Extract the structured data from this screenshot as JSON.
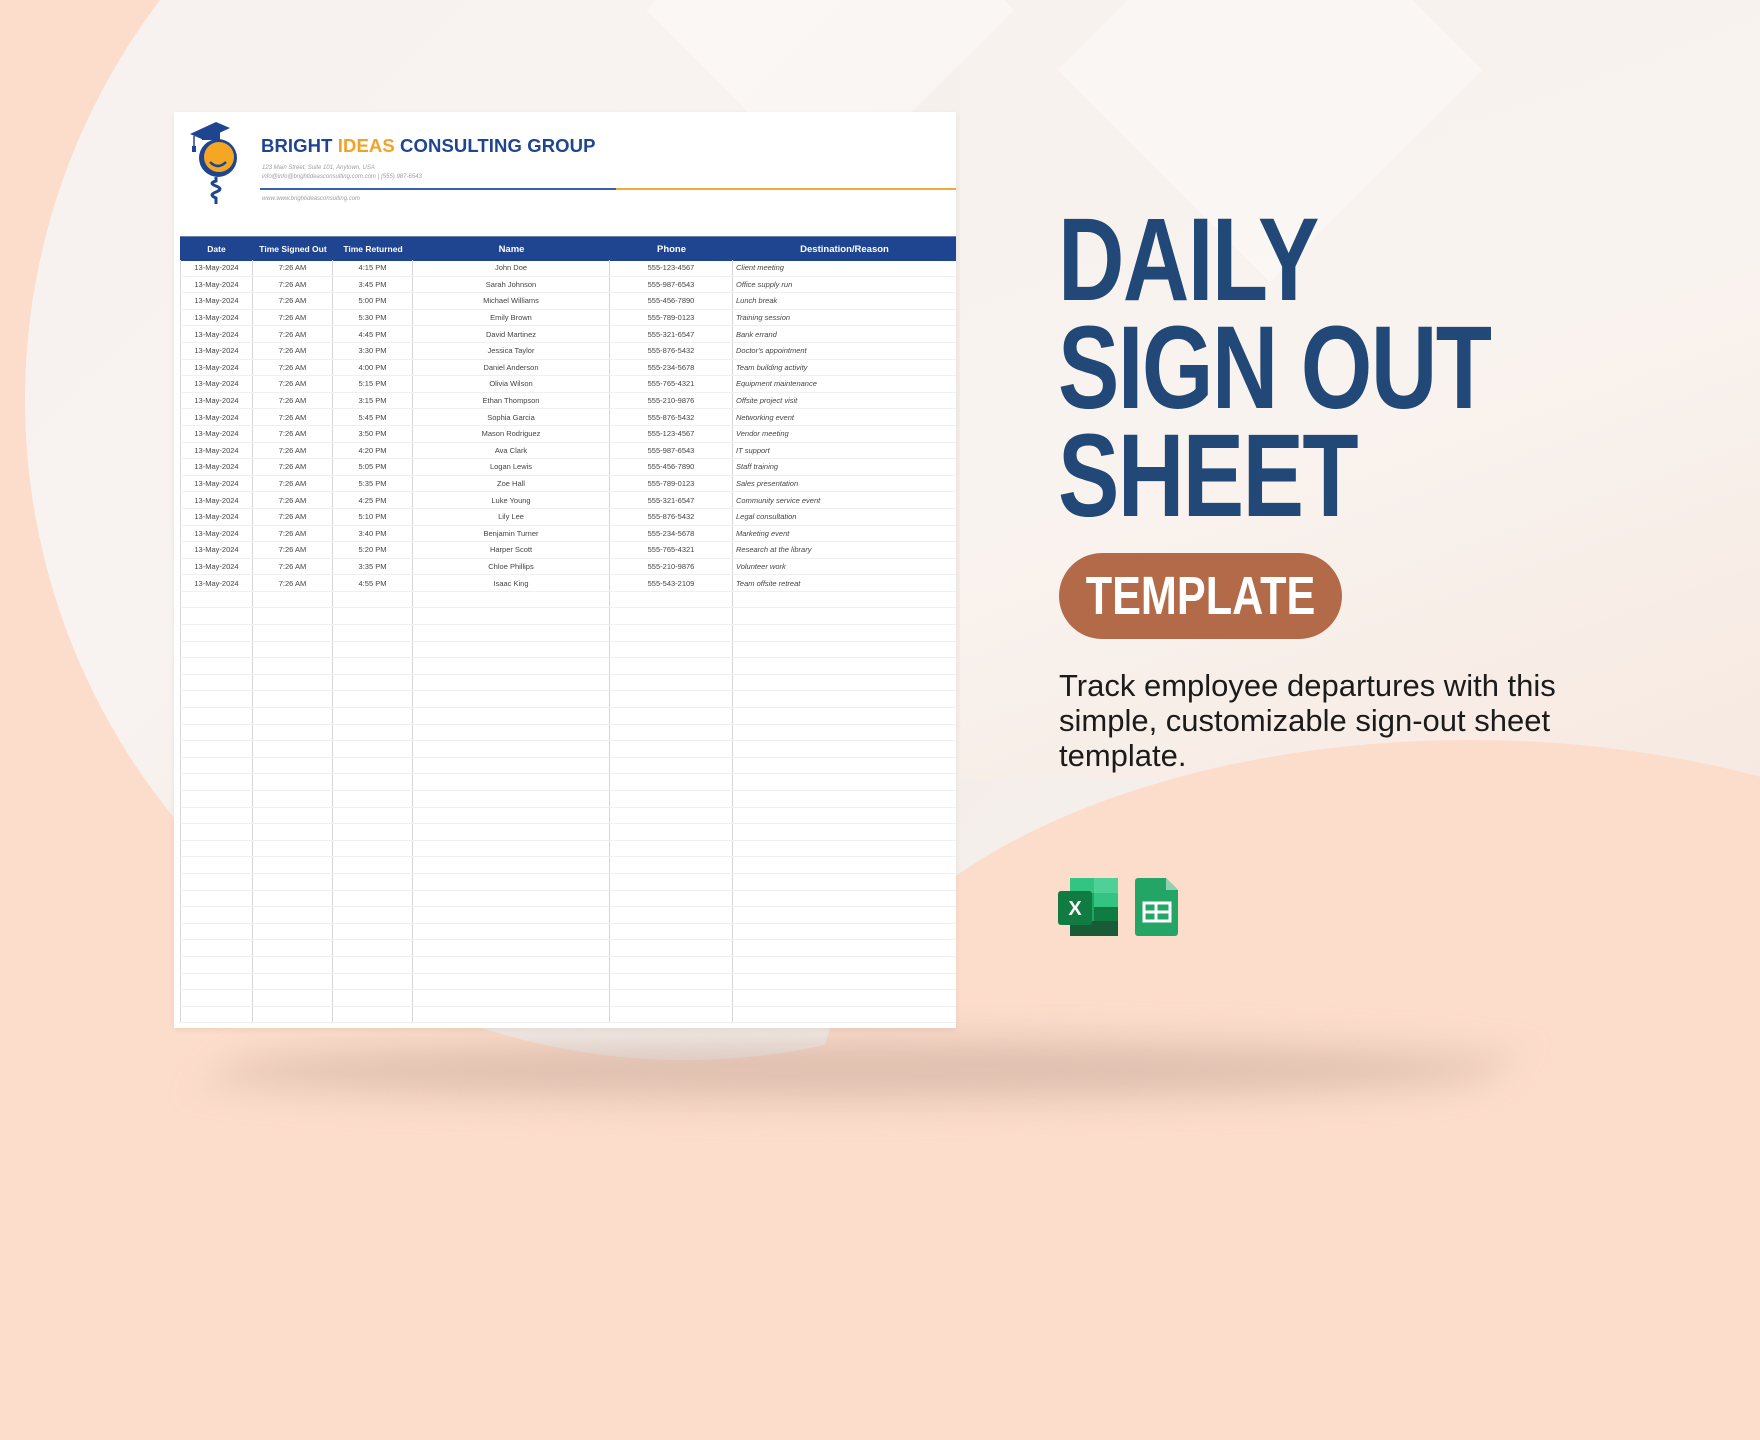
{
  "company": {
    "name_part1": "BRIGHT ",
    "name_accent": "IDEAS",
    "name_part2": " CONSULTING GROUP",
    "address": "123 Main Street, Suite 101, Anytown, USA",
    "contact": "info@info@brightideasconsulting.com.com | (555) 987-6543",
    "website": "www.www.brightideasconsulting.com"
  },
  "colors": {
    "brand_blue": "#1f4590",
    "brand_orange": "#f2a227",
    "title_blue": "#214876",
    "pill_brown": "#b26a48"
  },
  "table": {
    "headers": [
      "Date",
      "Time  Signed Out",
      "Time  Returned",
      "Name",
      "Phone",
      "Destination/Reason"
    ],
    "rows": [
      [
        "13-May-2024",
        "7:26 AM",
        "4:15 PM",
        "John Doe",
        "555-123-4567",
        "Client meeting"
      ],
      [
        "13-May-2024",
        "7:26 AM",
        "3:45 PM",
        "Sarah Johnson",
        "555-987-6543",
        "Office supply run"
      ],
      [
        "13-May-2024",
        "7:26 AM",
        "5:00 PM",
        "Michael Williams",
        "555-456-7890",
        "Lunch break"
      ],
      [
        "13-May-2024",
        "7:26 AM",
        "5:30 PM",
        "Emily Brown",
        "555-789-0123",
        "Training session"
      ],
      [
        "13-May-2024",
        "7:26 AM",
        "4:45 PM",
        "David Martinez",
        "555-321-6547",
        "Bank errand"
      ],
      [
        "13-May-2024",
        "7:26 AM",
        "3:30 PM",
        "Jessica Taylor",
        "555-876-5432",
        "Doctor's appointment"
      ],
      [
        "13-May-2024",
        "7:26 AM",
        "4:00 PM",
        "Daniel Anderson",
        "555-234-5678",
        "Team building activity"
      ],
      [
        "13-May-2024",
        "7:26 AM",
        "5:15 PM",
        "Olivia Wilson",
        "555-765-4321",
        "Equipment maintenance"
      ],
      [
        "13-May-2024",
        "7:26 AM",
        "3:15 PM",
        "Ethan Thompson",
        "555-210-9876",
        "Offsite project visit"
      ],
      [
        "13-May-2024",
        "7:26 AM",
        "5:45 PM",
        "Sophia Garcia",
        "555-876-5432",
        "Networking event"
      ],
      [
        "13-May-2024",
        "7:26 AM",
        "3:50 PM",
        "Mason Rodriguez",
        "555-123-4567",
        "Vendor meeting"
      ],
      [
        "13-May-2024",
        "7:26 AM",
        "4:20 PM",
        "Ava Clark",
        "555-987-6543",
        "IT support"
      ],
      [
        "13-May-2024",
        "7:26 AM",
        "5:05 PM",
        "Logan Lewis",
        "555-456-7890",
        "Staff training"
      ],
      [
        "13-May-2024",
        "7:26 AM",
        "5:35 PM",
        "Zoe Hall",
        "555-789-0123",
        "Sales presentation"
      ],
      [
        "13-May-2024",
        "7:26 AM",
        "4:25 PM",
        "Luke Young",
        "555-321-6547",
        "Community service event"
      ],
      [
        "13-May-2024",
        "7:26 AM",
        "5:10 PM",
        "Lily Lee",
        "555-876-5432",
        "Legal consultation"
      ],
      [
        "13-May-2024",
        "7:26 AM",
        "3:40 PM",
        "Benjamin Turner",
        "555-234-5678",
        "Marketing event"
      ],
      [
        "13-May-2024",
        "7:26 AM",
        "5:20 PM",
        "Harper Scott",
        "555-765-4321",
        "Research at the library"
      ],
      [
        "13-May-2024",
        "7:26 AM",
        "3:35 PM",
        "Chloe Phillips",
        "555-210-9876",
        "Volunteer work"
      ],
      [
        "13-May-2024",
        "7:26 AM",
        "4:55 PM",
        "Isaac King",
        "555-543-2109",
        "Team offsite retreat"
      ]
    ],
    "empty_rows": 26
  },
  "promo": {
    "title_lines": [
      "DAILY",
      "SIGN OUT",
      "SHEET"
    ],
    "badge": "TEMPLATE",
    "description": "Track employee departures with this simple, customizable sign-out sheet template.",
    "apps": [
      {
        "name": "excel-icon",
        "label": "X"
      },
      {
        "name": "google-sheets-icon"
      }
    ]
  }
}
